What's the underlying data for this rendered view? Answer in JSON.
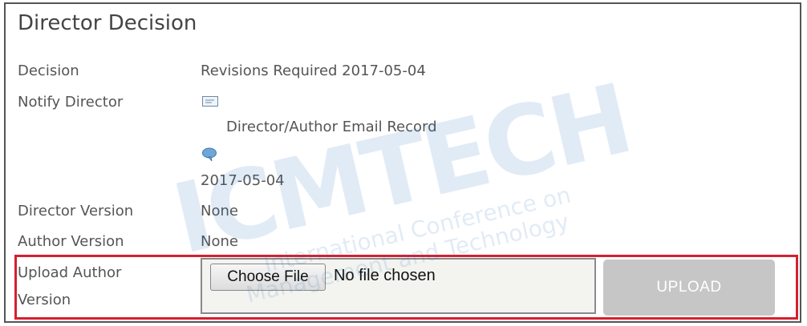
{
  "section": {
    "title": "Director Decision"
  },
  "rows": {
    "decision": {
      "label": "Decision",
      "value": "Revisions Required 2017-05-04"
    },
    "notify": {
      "label": "Notify Director",
      "email_record": "Director/Author Email Record",
      "date": "2017-05-04"
    },
    "director_version": {
      "label": "Director Version",
      "value": "None"
    },
    "author_version": {
      "label": "Author Version",
      "value": "None"
    },
    "upload": {
      "label_line1": "Upload Author",
      "label_line2": "Version",
      "choose_label": "Choose File",
      "file_status": "No file chosen",
      "upload_label": "UPLOAD"
    }
  },
  "icons": {
    "notify_email": "mail-icon",
    "notify_comment": "chat-bubble-icon"
  },
  "watermark": {
    "logo_text": "ICMTECH",
    "tagline_line1": "International Conference on",
    "tagline_line2": "Management and Technology"
  },
  "colors": {
    "highlight_border": "#d42030",
    "upload_button_bg": "#c6c6c6",
    "text": "#555555"
  }
}
